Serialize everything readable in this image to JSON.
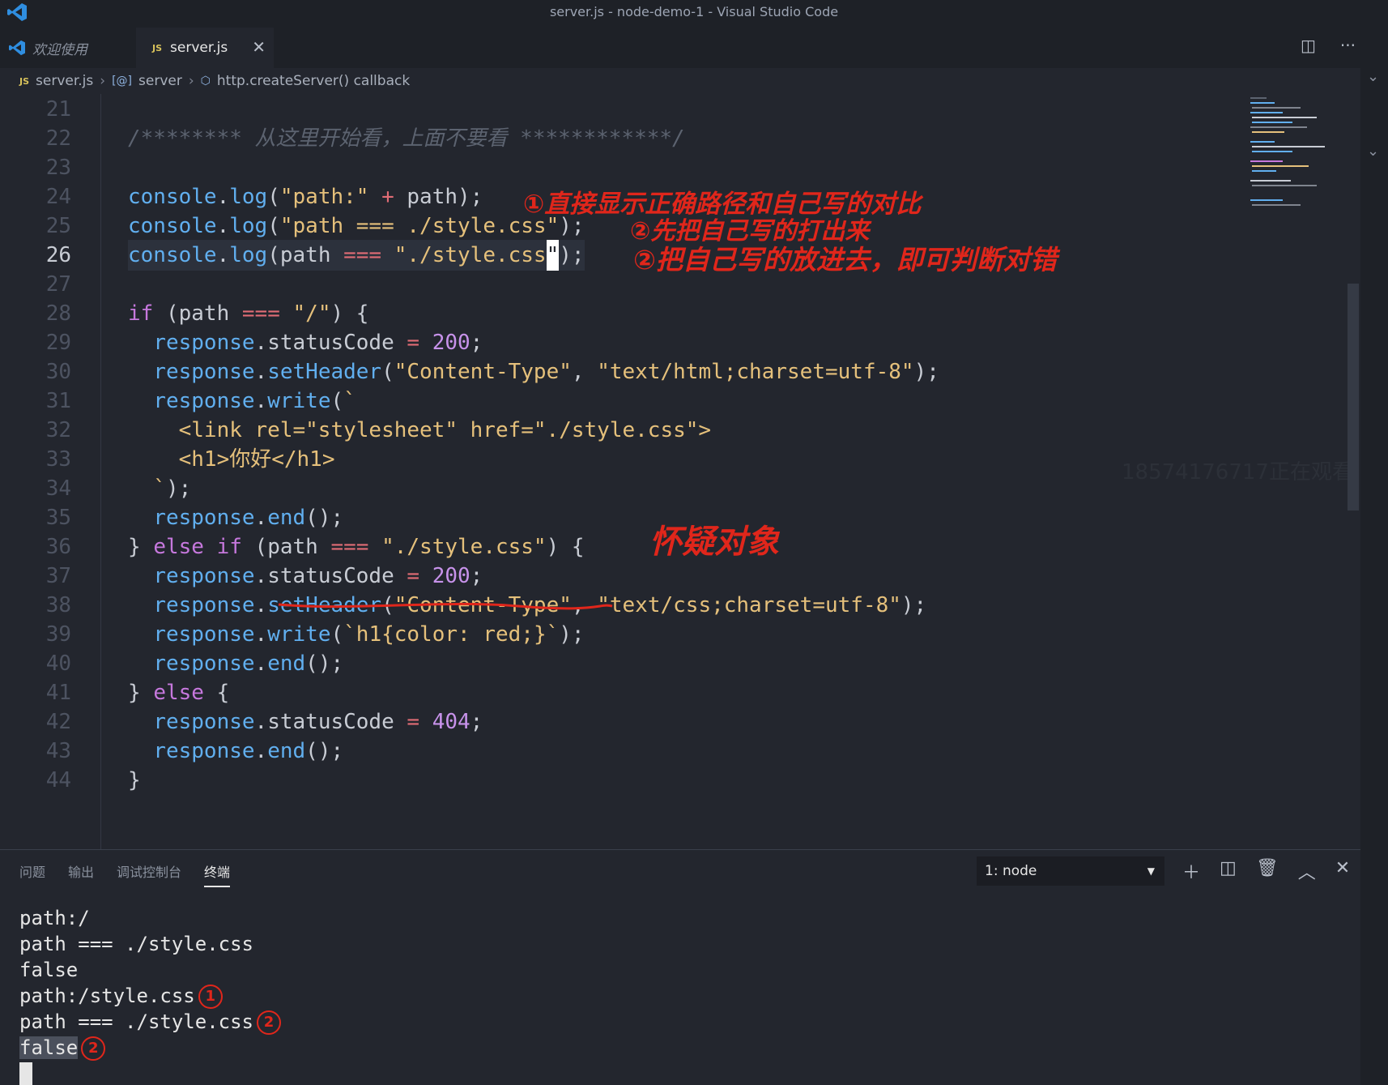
{
  "window": {
    "title": "server.js - node-demo-1 - Visual Studio Code"
  },
  "tabs": [
    {
      "label": "欢迎使用"
    },
    {
      "label": "server.js",
      "badge": "JS"
    }
  ],
  "breadcrumb": {
    "file": "server.js",
    "badge": "JS",
    "symbol": "server",
    "symbol_tag": "[@]",
    "callback": "http.createServer() callback"
  },
  "editor": {
    "line_numbers": [
      "21",
      "22",
      "23",
      "24",
      "25",
      "26",
      "27",
      "28",
      "29",
      "30",
      "31",
      "32",
      "33",
      "34",
      "35",
      "36",
      "37",
      "38",
      "39",
      "40",
      "41",
      "42",
      "43",
      "44"
    ],
    "current_line": "26"
  },
  "annotations": {
    "a1": "①直接显示正确路径和自己写的对比",
    "a2": "②先把自己写的打出来",
    "a3": "②把自己写的放进去，即可判断对错",
    "a4": "怀疑对象"
  },
  "watermark": "18574176717正在观看",
  "panel": {
    "tabs": [
      "问题",
      "输出",
      "调试控制台",
      "终端"
    ],
    "active_tab": "终端",
    "terminal_select": "1: node",
    "terminal_lines": [
      "path:/",
      "path === ./style.css",
      "false",
      "path:/style.css",
      "path === ./style.css",
      "false"
    ],
    "circle_marks": [
      "1",
      "2",
      "2"
    ]
  },
  "colors": {
    "annotation": "#e0261b",
    "editor_bg": "#23262e",
    "string": "#e5c07b",
    "keyword": "#c678dd",
    "function": "#61afef"
  }
}
